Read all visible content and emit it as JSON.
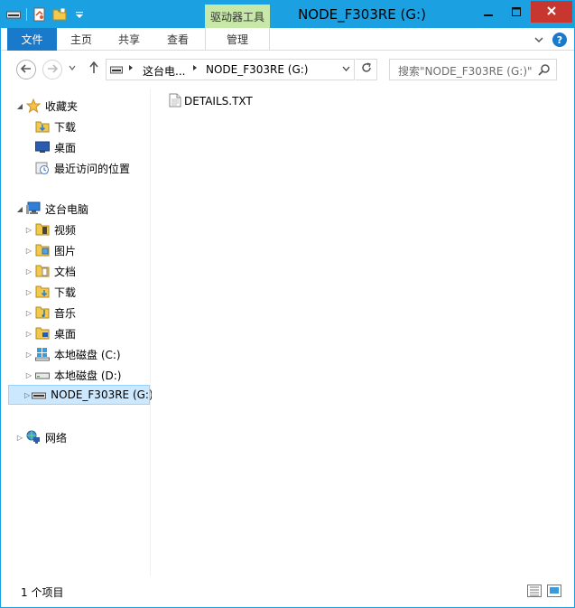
{
  "window": {
    "title": "NODE_F303RE (G:)",
    "context_tab_group": "驱动器工具"
  },
  "ribbon": {
    "tabs": [
      {
        "label": "文件"
      },
      {
        "label": "主页"
      },
      {
        "label": "共享"
      },
      {
        "label": "查看"
      },
      {
        "label": "管理"
      }
    ]
  },
  "address": {
    "segments": [
      "这台电...",
      "NODE_F303RE (G:)"
    ]
  },
  "search": {
    "placeholder": "搜索\"NODE_F303RE (G:)\""
  },
  "nav_tree": {
    "favorites": {
      "label": "收藏夹",
      "items": [
        {
          "label": "下载",
          "icon": "downloads-folder-icon"
        },
        {
          "label": "桌面",
          "icon": "desktop-icon"
        },
        {
          "label": "最近访问的位置",
          "icon": "recent-places-icon"
        }
      ]
    },
    "this_pc": {
      "label": "这台电脑",
      "items": [
        {
          "label": "视频",
          "icon": "videos-folder-icon"
        },
        {
          "label": "图片",
          "icon": "pictures-folder-icon"
        },
        {
          "label": "文档",
          "icon": "documents-folder-icon"
        },
        {
          "label": "下载",
          "icon": "downloads-folder-icon"
        },
        {
          "label": "音乐",
          "icon": "music-folder-icon"
        },
        {
          "label": "桌面",
          "icon": "desktop-folder-icon"
        },
        {
          "label": "本地磁盘 (C:)",
          "icon": "windows-drive-icon"
        },
        {
          "label": "本地磁盘 (D:)",
          "icon": "drive-icon"
        },
        {
          "label": "NODE_F303RE (G:)",
          "icon": "removable-drive-icon",
          "selected": true
        }
      ]
    },
    "network": {
      "label": "网络"
    }
  },
  "files": [
    {
      "name": "DETAILS.TXT",
      "icon": "text-file-icon"
    }
  ],
  "status": {
    "item_count": "1 个项目"
  },
  "colors": {
    "titlebar": "#1ba1e2",
    "file_tab": "#1979ca",
    "context_tab": "#c7e8a8",
    "close_button": "#c7372f",
    "selection": "#cce8ff"
  }
}
